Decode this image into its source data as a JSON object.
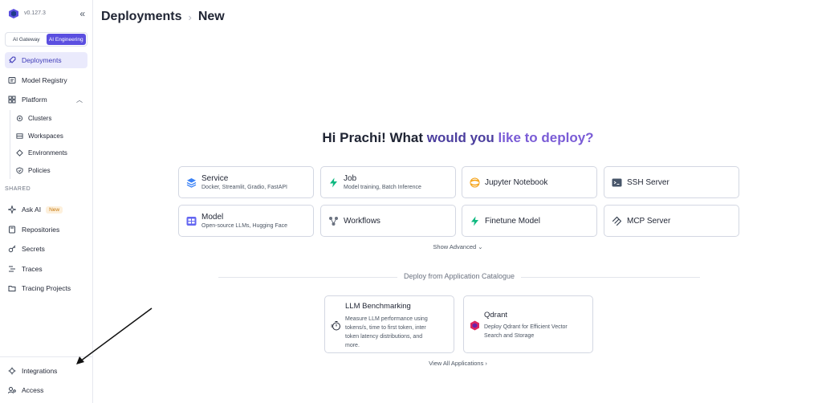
{
  "sidebar": {
    "version": "v0.127.3",
    "collapse_icon": "«",
    "segments": [
      {
        "label": "AI Gateway",
        "active": false
      },
      {
        "label": "AI Engineering",
        "active": true
      }
    ],
    "items": [
      {
        "label": "Deployments",
        "icon": "rocket-icon",
        "active": true
      },
      {
        "label": "Model Registry",
        "icon": "registry-icon"
      },
      {
        "label": "Platform",
        "icon": "platform-icon",
        "expanded": true
      }
    ],
    "sub_items": [
      {
        "label": "Clusters",
        "icon": "cluster-icon"
      },
      {
        "label": "Workspaces",
        "icon": "workspace-icon"
      },
      {
        "label": "Environments",
        "icon": "environment-icon"
      },
      {
        "label": "Policies",
        "icon": "policy-icon"
      }
    ],
    "shared_label": "SHARED",
    "shared_items": [
      {
        "label": "Ask AI",
        "icon": "sparkle-icon",
        "badge": "New"
      },
      {
        "label": "Repositories",
        "icon": "repository-icon"
      },
      {
        "label": "Secrets",
        "icon": "key-icon"
      },
      {
        "label": "Traces",
        "icon": "traces-icon"
      },
      {
        "label": "Tracing Projects",
        "icon": "folder-icon"
      }
    ],
    "bottom_items": [
      {
        "label": "Integrations",
        "icon": "plug-icon"
      },
      {
        "label": "Access",
        "icon": "access-icon"
      }
    ]
  },
  "header": {
    "breadcrumb": [
      "Deployments",
      "New"
    ],
    "separator": "›"
  },
  "hero": {
    "part1": "Hi Prachi! What ",
    "part2": "would you ",
    "part3": "like to deploy?"
  },
  "deploy_cards": [
    {
      "title": "Service",
      "subtitle": "Docker, Streamlit, Gradio, FastAPI",
      "icon": "layers-icon",
      "color": "#3b82f6"
    },
    {
      "title": "Job",
      "subtitle": "Model training, Batch Inference",
      "icon": "bolt-icon",
      "color": "#10b981"
    },
    {
      "title": "Jupyter Notebook",
      "subtitle": "",
      "icon": "jupyter-icon",
      "color": "#f59e0b"
    },
    {
      "title": "SSH Server",
      "subtitle": "",
      "icon": "terminal-icon",
      "color": "#475569"
    },
    {
      "title": "Model",
      "subtitle": "Open-source LLMs, Hugging Face",
      "icon": "model-icon",
      "color": "#6366f1"
    },
    {
      "title": "Workflows",
      "subtitle": "",
      "icon": "workflow-icon",
      "color": "#6b7280"
    },
    {
      "title": "Finetune Model",
      "subtitle": "",
      "icon": "bolt-icon",
      "color": "#10b981"
    },
    {
      "title": "MCP Server",
      "subtitle": "",
      "icon": "mcp-icon",
      "color": "#374151"
    }
  ],
  "show_advanced": "Show Advanced ⌄",
  "catalogue_label": "Deploy from Application Catalogue",
  "apps": [
    {
      "title": "LLM Benchmarking",
      "desc": [
        "Measure LLM performance using",
        "tokens/s, time to first token, inter",
        "token latency distributions, and",
        "more."
      ],
      "icon": "stopwatch-icon"
    },
    {
      "title": "Qdrant",
      "desc": [
        "Deploy Qdrant for Efficient Vector",
        "Search and Storage"
      ],
      "icon": "qdrant-icon"
    }
  ],
  "view_all": "View All Applications ›"
}
